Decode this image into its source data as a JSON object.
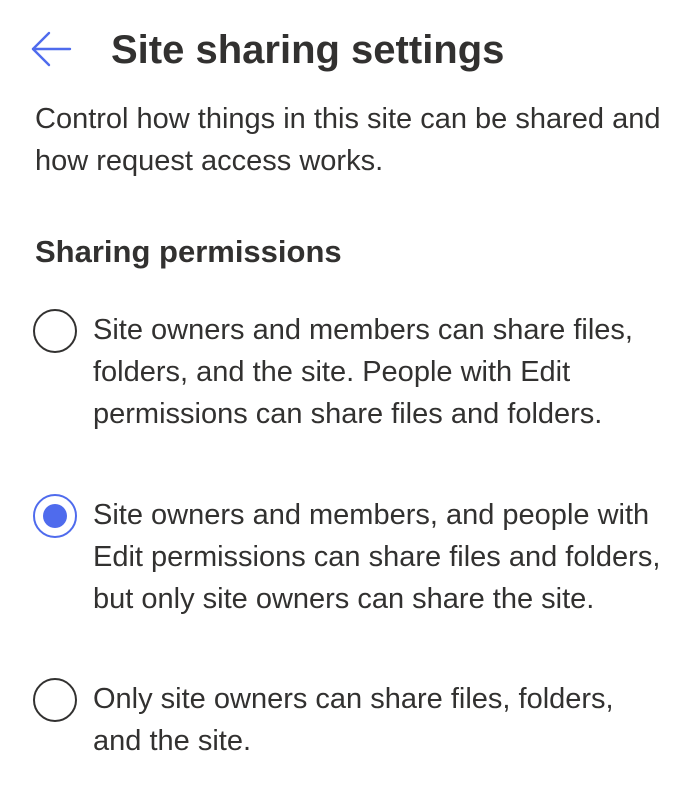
{
  "header": {
    "title": "Site sharing settings",
    "back_icon": "arrow-left-icon"
  },
  "description": "Control how things in this site can be shared and how request access works.",
  "sharing_permissions": {
    "title": "Sharing permissions",
    "options": [
      {
        "label": "Site owners and members can share files, folders, and the site. People with Edit permissions can share files and folders.",
        "selected": false
      },
      {
        "label": "Site owners and members, and people with Edit permissions can share files and folders, but only site owners can share the site.",
        "selected": true
      },
      {
        "label": "Only site owners can share files, folders, and the site.",
        "selected": false
      }
    ]
  },
  "colors": {
    "accent": "#4f6bed",
    "text": "#323130",
    "background": "#ffffff"
  }
}
